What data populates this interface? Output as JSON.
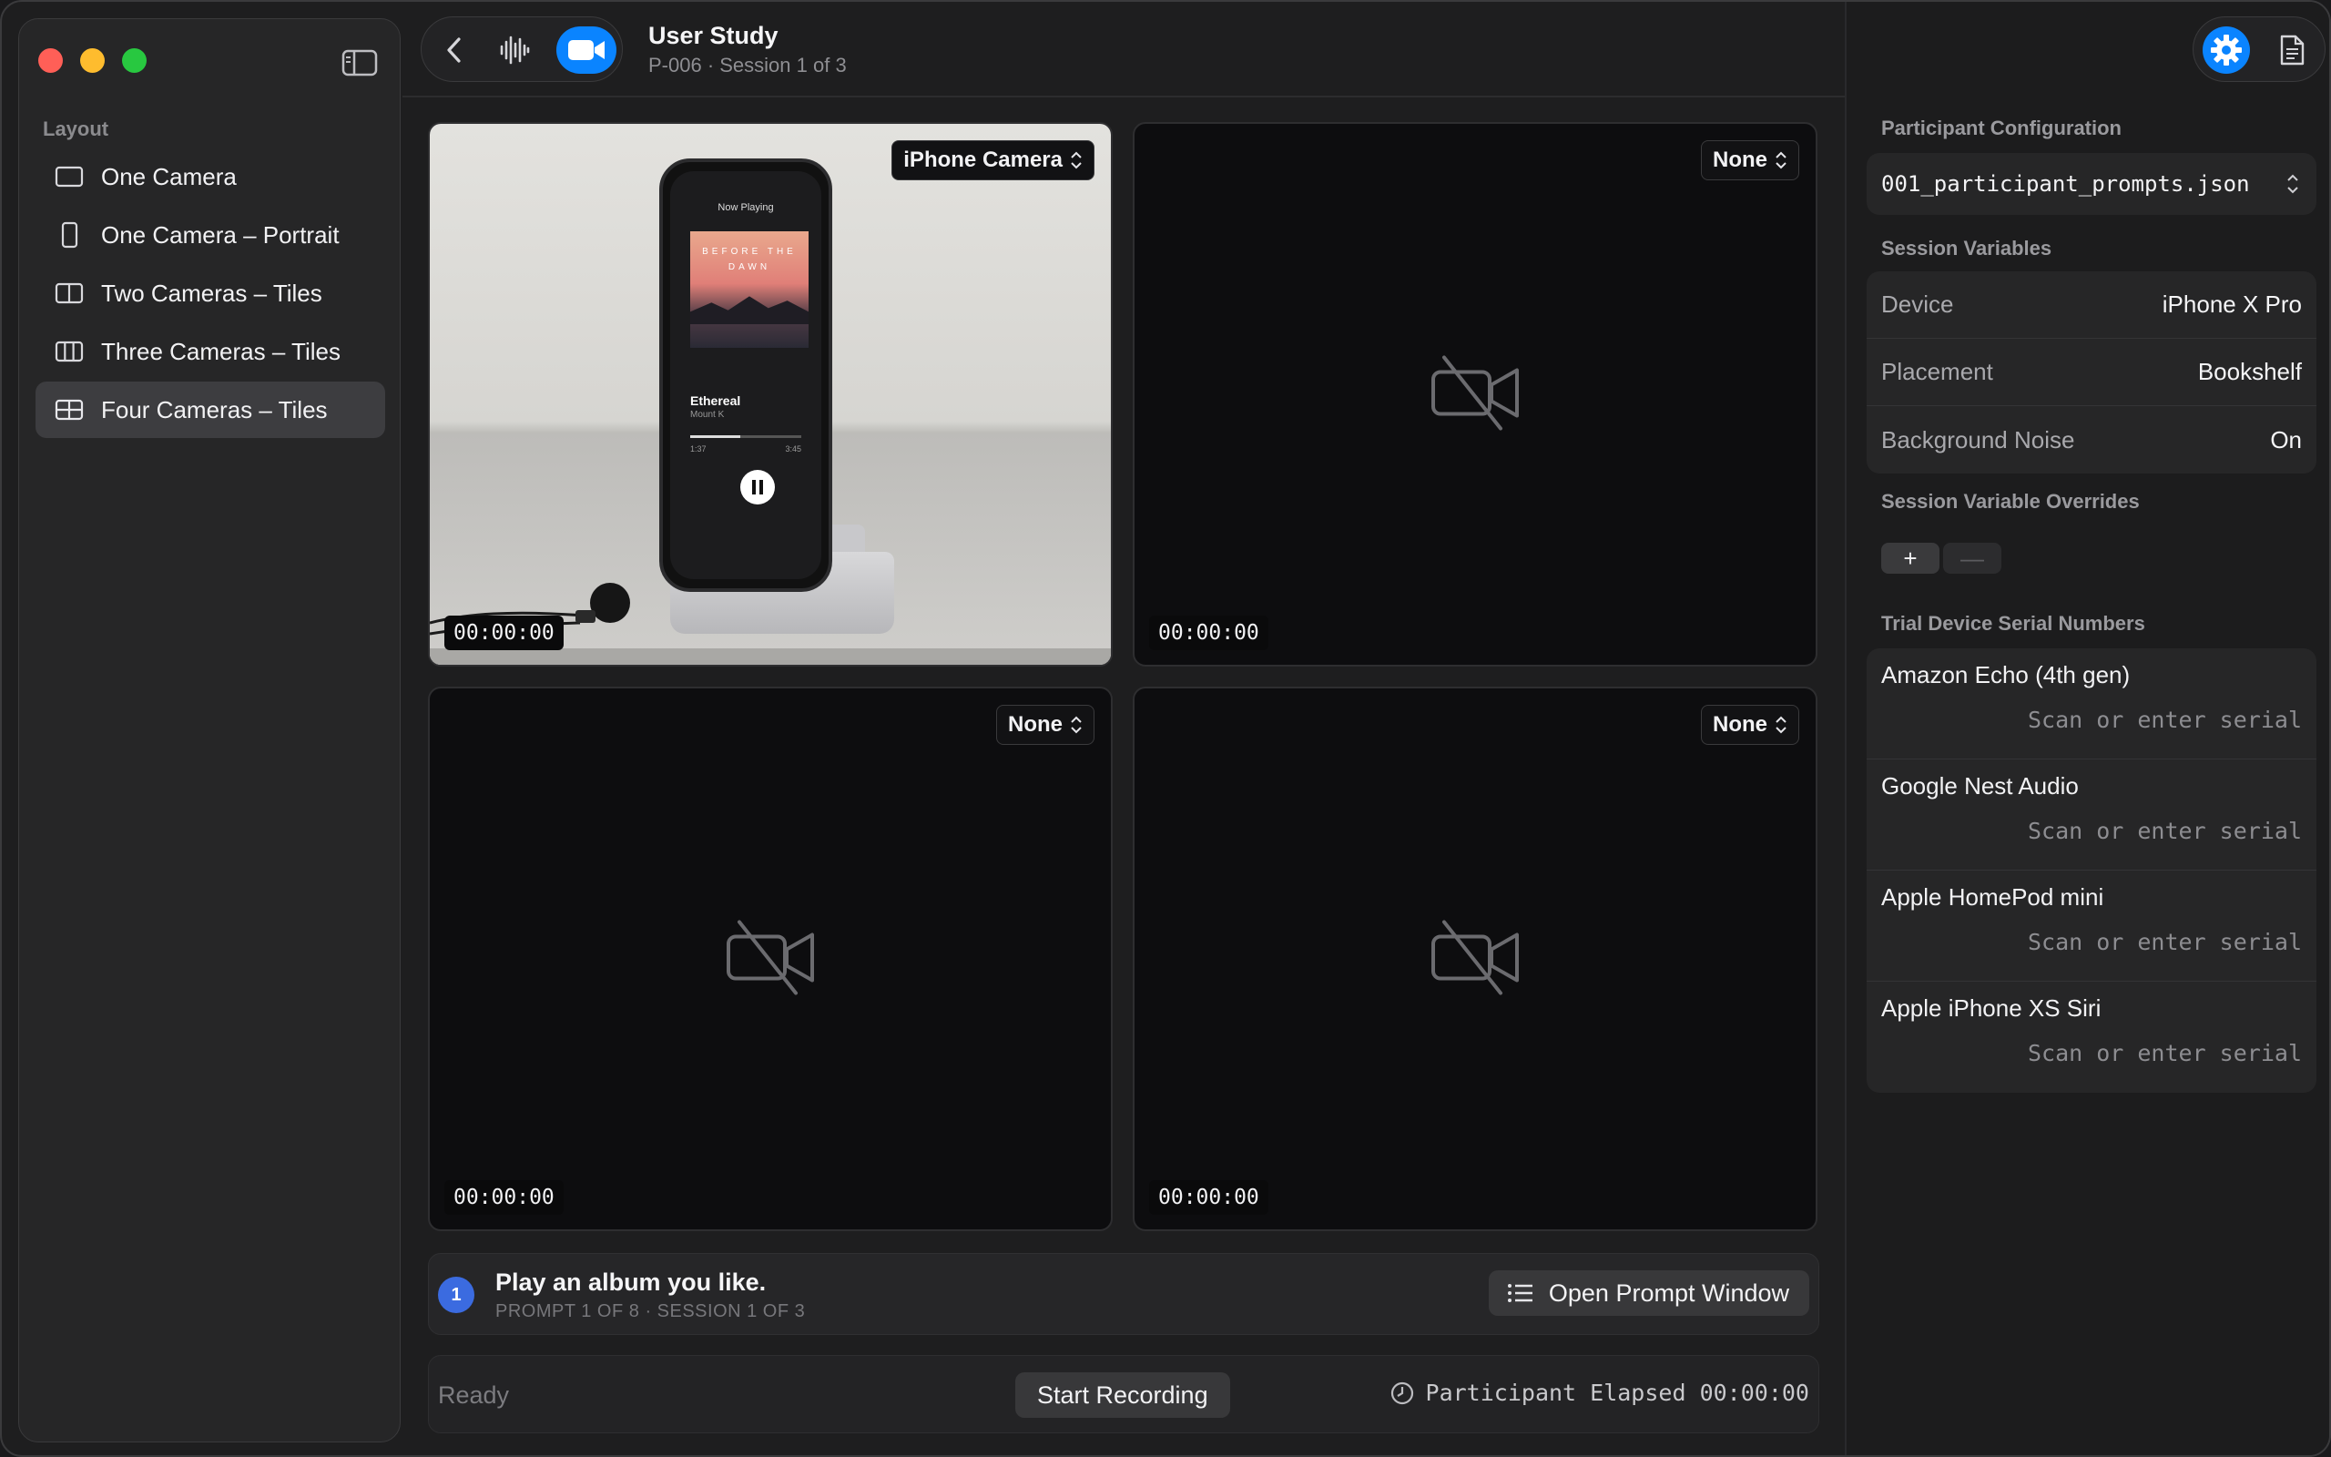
{
  "sidebar": {
    "section_title": "Layout",
    "items": [
      {
        "label": "One Camera",
        "icon": "single-frame-icon",
        "selected": false
      },
      {
        "label": "One Camera – Portrait",
        "icon": "portrait-frame-icon",
        "selected": false
      },
      {
        "label": "Two Cameras – Tiles",
        "icon": "two-tiles-icon",
        "selected": false
      },
      {
        "label": "Three Cameras – Tiles",
        "icon": "three-tiles-icon",
        "selected": false
      },
      {
        "label": "Four Cameras – Tiles",
        "icon": "four-tiles-icon",
        "selected": true
      }
    ]
  },
  "header": {
    "title": "User Study",
    "subtitle": "P-006 · Session 1 of 3"
  },
  "tiles": [
    {
      "source": "iPhone Camera",
      "timecode": "00:00:00",
      "live": true
    },
    {
      "source": "None",
      "timecode": "00:00:00",
      "live": false
    },
    {
      "source": "None",
      "timecode": "00:00:00",
      "live": false
    },
    {
      "source": "None",
      "timecode": "00:00:00",
      "live": false
    }
  ],
  "phone_screen": {
    "header": "Now Playing",
    "album_art_text": "BEFORE THE DAWN",
    "song": "Ethereal",
    "artist": "Mount K",
    "time_elapsed": "1:37",
    "time_total": "3:45",
    "progress": 0.45
  },
  "prompt": {
    "number": "1",
    "text": "Play an album you like.",
    "meta": "PROMPT 1 OF 8 · SESSION 1 OF 3",
    "open_button": "Open Prompt Window"
  },
  "status": {
    "state": "Ready",
    "start_button": "Start Recording",
    "elapsed_label": "Participant Elapsed",
    "elapsed_value": "00:00:00"
  },
  "inspector": {
    "participant_config_title": "Participant Configuration",
    "config_file": "001_participant_prompts.json",
    "session_variables_title": "Session Variables",
    "variables": [
      {
        "label": "Device",
        "value": "iPhone X Pro"
      },
      {
        "label": "Placement",
        "value": "Bookshelf"
      },
      {
        "label": "Background Noise",
        "value": "On"
      }
    ],
    "overrides_title": "Session Variable Overrides",
    "add_label": "+",
    "remove_label": "—",
    "serials_title": "Trial Device Serial Numbers",
    "serial_placeholder": "Scan or enter serial",
    "serials": [
      {
        "device": "Amazon Echo (4th gen)",
        "value": ""
      },
      {
        "device": "Google Nest Audio",
        "value": ""
      },
      {
        "device": "Apple HomePod mini",
        "value": ""
      },
      {
        "device": "Apple iPhone XS Siri",
        "value": ""
      }
    ]
  },
  "colors": {
    "accent": "#0a84ff",
    "prompt_badge": "#3b6be0",
    "close": "#ff5f57",
    "minimize": "#febc2e",
    "zoom": "#28c840"
  }
}
